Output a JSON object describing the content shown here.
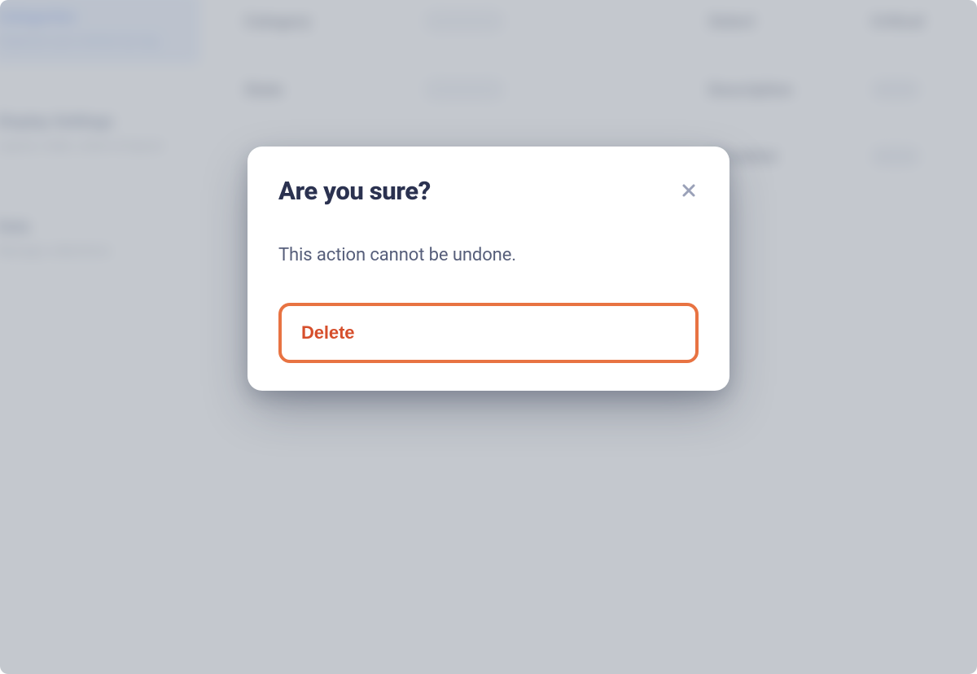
{
  "modal": {
    "title": "Are you sure?",
    "message": "This action cannot be undone.",
    "delete_label": "Delete",
    "close_icon_name": "close-icon"
  },
  "background": {
    "sidebar": {
      "items": [
        {
          "title": "Categories",
          "subtitle": "Organize your entries by tag",
          "selected": true
        },
        {
          "title": "Display Settings",
          "subtitle": "Layout, order, colors & layout"
        },
        {
          "title": "Data",
          "subtitle": "Manage collections"
        }
      ]
    },
    "form_rows": [
      {
        "label": "Category",
        "right_label": "Select",
        "right_label2": "Critical"
      },
      {
        "label": "State",
        "right_label": "Description",
        "right_label2": ""
      },
      {
        "label": "",
        "right_label": "Checklist",
        "right_label2": ""
      }
    ]
  },
  "colors": {
    "accent_orange": "#e87342",
    "text_heading": "#2b3250",
    "text_body": "#565e7a"
  }
}
